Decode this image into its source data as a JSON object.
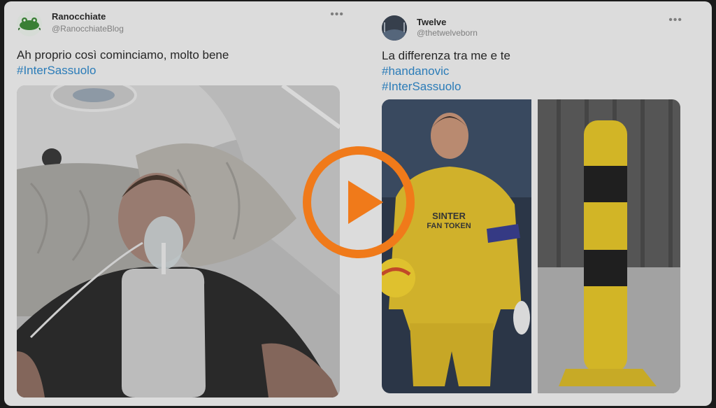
{
  "tweets": [
    {
      "name": "Ranocchiate",
      "handle": "@RanocchiateBlog",
      "text": "Ah proprio così cominciamo, molto bene",
      "hashtags": [
        "#InterSassuolo"
      ],
      "more_icon": "more-icon",
      "avatar_icon": "frog-icon"
    },
    {
      "name": "Twelve",
      "handle": "@thetwelveborn",
      "text": "La differenza tra me e te",
      "hashtags": [
        "#handanovic",
        "#InterSassuolo"
      ],
      "more_icon": "more-icon",
      "avatar_icon": "stadium-icon",
      "jersey_sponsor": "SINTER",
      "jersey_sponsor_sub": "FAN TOKEN"
    }
  ],
  "player": {
    "play_icon": "play-icon",
    "accent": "#f07a1a"
  }
}
